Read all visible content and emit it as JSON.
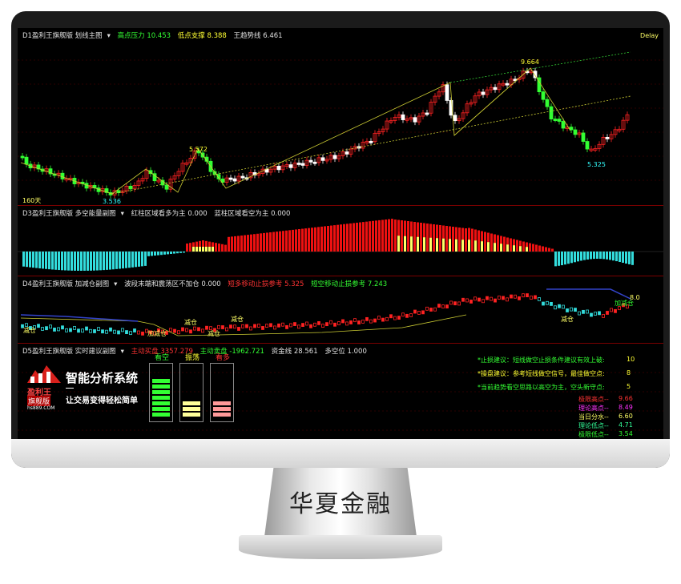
{
  "brand": "华夏金融",
  "panel1": {
    "title": "D1盈利王旗舰版 划线主图",
    "items": [
      {
        "label": "高点压力 10.453",
        "color": "#33ff33"
      },
      {
        "label": "低点支撑 8.388",
        "color": "#ffff33"
      },
      {
        "label": "王趋势线 6.461",
        "color": "#e0e0e0"
      }
    ],
    "delay": "Delay",
    "high_label": "9.664",
    "mid_label": "5.572",
    "low_label": "3.536",
    "right_low": "5.325",
    "ma_label": "160天"
  },
  "panel2": {
    "title": "D3盈利王旗舰版 多空能量副图",
    "items": [
      {
        "label": "红柱区域看多为主 0.000",
        "color": "#e0e0e0"
      },
      {
        "label": "蓝柱区域看空为主 0.000",
        "color": "#e0e0e0"
      }
    ]
  },
  "panel3": {
    "title": "D4盈利王旗舰版 加减仓副图",
    "items": [
      {
        "label": "波段末端和震荡区不加仓 0.000",
        "color": "#e0e0e0"
      },
      {
        "label": "短多移动止损参考 5.325",
        "color": "#ff3333"
      },
      {
        "label": "短空移动止损参考 7.243",
        "color": "#33ff33"
      }
    ],
    "signals": [
      "减仓",
      "减仓",
      "减仓",
      "加减仓",
      "减仓",
      "减仓",
      "减仓",
      "加减仓"
    ],
    "value": "8.0"
  },
  "panel4": {
    "title": "D5盈利王旗舰版 实时建议副图",
    "items": [
      {
        "label": "主动买盘 3357.279",
        "color": "#ff3333"
      },
      {
        "label": "主动卖盘 -1962.721",
        "color": "#33ff33"
      },
      {
        "label": "资金线 28.561",
        "color": "#e0e0e0"
      },
      {
        "label": "多空位 1.000",
        "color": "#e0e0e0"
      }
    ],
    "logo_text": [
      "盈利王",
      "旗舰版",
      "hs889.COM"
    ],
    "slogan_main": "智能分析系统",
    "slogan_sub": "让交易变得轻松简单",
    "gauges": [
      {
        "label": "看空",
        "color": "#33ff33",
        "level": 7
      },
      {
        "label": "振荡",
        "color": "#ffff99",
        "level": 3
      },
      {
        "label": "看多",
        "color": "#ff9999",
        "level": 3
      }
    ],
    "advice": [
      {
        "text": "*止损建议：短线做空止损条件建议有效上破:",
        "value": "10"
      },
      {
        "text": "*操盘建议：参考短线做空信号，最佳做空点:",
        "value": "8"
      },
      {
        "text": "*当前趋势看空思路以高空为主，空头新守点:",
        "value": "5"
      }
    ],
    "levels": [
      {
        "label": "极限高点--",
        "value": "9.66",
        "color": "#ff3333"
      },
      {
        "label": "理论高点--",
        "value": "8.49",
        "color": "#ff33ff"
      },
      {
        "label": "当日分水--",
        "value": "6.60",
        "color": "#ffff66"
      },
      {
        "label": "理论低点--",
        "value": "4.71",
        "color": "#33ff99"
      },
      {
        "label": "极限低点--",
        "value": "3.54",
        "color": "#33ff33"
      }
    ]
  }
}
